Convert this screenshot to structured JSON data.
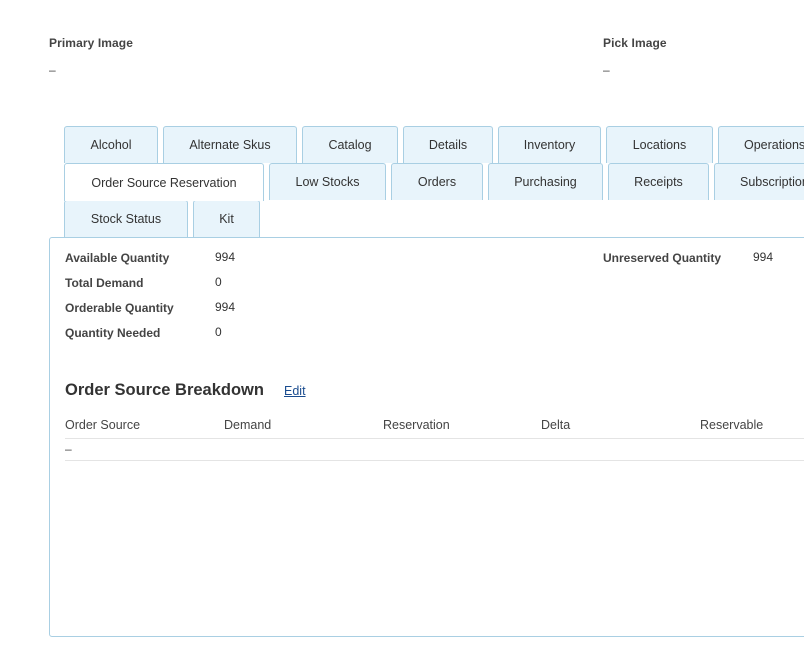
{
  "images": {
    "primary": {
      "label": "Primary Image",
      "value": "–"
    },
    "pick": {
      "label": "Pick Image",
      "value": "–"
    }
  },
  "tabs": {
    "row1": [
      {
        "label": "Alcohol"
      },
      {
        "label": "Alternate Skus"
      },
      {
        "label": "Catalog"
      },
      {
        "label": "Details"
      },
      {
        "label": "Inventory"
      },
      {
        "label": "Locations"
      },
      {
        "label": "Operations"
      }
    ],
    "row2": [
      {
        "label": "Order Source Reservation"
      },
      {
        "label": "Low Stocks"
      },
      {
        "label": "Orders"
      },
      {
        "label": "Purchasing"
      },
      {
        "label": "Receipts"
      },
      {
        "label": "Subscriptions"
      }
    ],
    "row3": [
      {
        "label": "Stock Status"
      },
      {
        "label": "Kit"
      }
    ],
    "active": "Order Source Reservation"
  },
  "quantities": {
    "available": {
      "label": "Available Quantity",
      "value": "994"
    },
    "total_demand": {
      "label": "Total Demand",
      "value": "0"
    },
    "orderable": {
      "label": "Orderable Quantity",
      "value": "994"
    },
    "needed": {
      "label": "Quantity Needed",
      "value": "0"
    },
    "unreserved": {
      "label": "Unreserved Quantity",
      "value": "994"
    }
  },
  "breakdown": {
    "title": "Order Source Breakdown",
    "edit_label": "Edit",
    "columns": [
      "Order Source",
      "Demand",
      "Reservation",
      "Delta",
      "Reservable"
    ],
    "empty_value": "–"
  },
  "colors": {
    "tab_bg": "#e8f4fb",
    "tab_border": "#a9cfe3",
    "link": "#1a4c8f"
  }
}
